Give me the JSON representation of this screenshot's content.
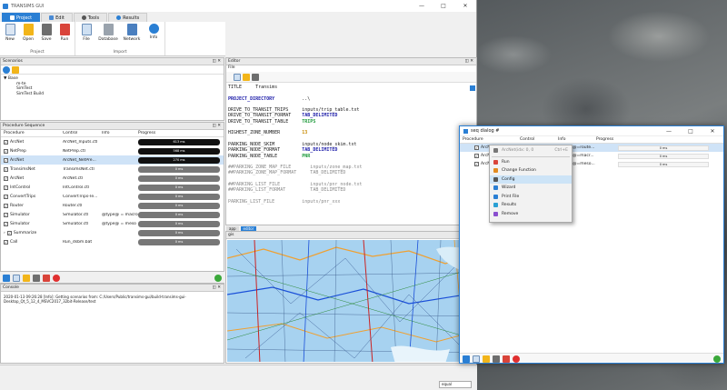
{
  "app": {
    "title": "TRANSIMS GUI",
    "tabs": [
      {
        "label": "Project"
      },
      {
        "label": "Edit"
      },
      {
        "label": "Tools"
      },
      {
        "label": "Results"
      }
    ]
  },
  "ribbon": {
    "project": {
      "label": "Project",
      "buttons": [
        "New",
        "Open",
        "Save",
        "Run"
      ]
    },
    "import": {
      "label": "Import",
      "buttons": [
        "File",
        "Database",
        "Network",
        "Info"
      ]
    }
  },
  "scenarios": {
    "title": "Scenarios",
    "root": "Base",
    "children": [
      "m-te",
      "SimTest",
      "SimTest Build"
    ]
  },
  "procedure": {
    "title": "Procedure Sequence",
    "headers": {
      "procedure": "Procedure",
      "control": "Control",
      "info": "Info",
      "progress": "Progress"
    },
    "rows": [
      {
        "name": "ArcNet",
        "control": "ArcNet_Inputs.ctl",
        "info": "",
        "progress": "613 ms",
        "dark": true,
        "selected": false
      },
      {
        "name": "NetPrep",
        "control": "NetPrep.ctl",
        "info": "",
        "progress": "568 ms",
        "dark": true,
        "selected": false
      },
      {
        "name": "ArcNet",
        "control": "ArcNet_NetPre...",
        "info": "",
        "progress": "270 ms",
        "dark": true,
        "selected": true
      },
      {
        "name": "TransimsNet",
        "control": "TransimsNet.ctl",
        "info": "",
        "progress": "0 ms",
        "dark": false,
        "selected": false
      },
      {
        "name": "ArcNet",
        "control": "ArcNet.ctl",
        "info": "",
        "progress": "0 ms",
        "dark": false,
        "selected": false
      },
      {
        "name": "IntControl",
        "control": "IntControl.ctl",
        "info": "",
        "progress": "0 ms",
        "dark": false,
        "selected": false
      },
      {
        "name": "ConvertTrips",
        "control": "ConvertTrips-Te...",
        "info": "",
        "progress": "0 ms",
        "dark": false,
        "selected": false
      },
      {
        "name": "Router",
        "control": "Router.ctl",
        "info": "",
        "progress": "0 ms",
        "dark": false,
        "selected": false
      },
      {
        "name": "Simulator",
        "control": "Simulator.ctl",
        "info": "@type@ = macro",
        "progress": "0 ms",
        "dark": false,
        "selected": false
      },
      {
        "name": "Simulator",
        "control": "Simulator.ctl",
        "info": "@type@ = meso",
        "progress": "0 ms",
        "dark": false,
        "selected": false
      },
      {
        "name": "Summarize",
        "control": "",
        "info": "",
        "progress": "0 ms",
        "dark": false,
        "selected": false
      },
      {
        "name": "Call",
        "control": "Run_dsbm.bat",
        "info": "",
        "progress": "0 ms",
        "dark": false,
        "selected": false
      }
    ]
  },
  "console": {
    "title": "Console",
    "text": "2020-01-13 09:26:28 [Info]: Getting scenarios from: C:/Users/Public/transims-gui/build-transims-gui-Desktop_Qt_5_12_4_MSVC2017_32bit-Release/test"
  },
  "editor": {
    "title": "Editor",
    "menu": "File",
    "tabs": [
      "app",
      "editor"
    ],
    "lines": [
      [
        {
          "t": "TITLE     Transims",
          "c": ""
        }
      ],
      [
        {
          "t": "",
          "c": ""
        }
      ],
      [
        {
          "t": "PROJECT_DIRECTORY",
          "c": "kw"
        },
        {
          "t": "          ..\\",
          "c": ""
        }
      ],
      [
        {
          "t": "",
          "c": ""
        }
      ],
      [
        {
          "t": "DRIVE_TO_TRANSIT_TRIPS     inputs/trip_table.txt",
          "c": ""
        }
      ],
      [
        {
          "t": "DRIVE_TO_TRANSIT_FORMAT    ",
          "c": ""
        },
        {
          "t": "TAB_DELIMITED",
          "c": "kw"
        }
      ],
      [
        {
          "t": "DRIVE_TO_TRANSIT_TABLE     ",
          "c": ""
        },
        {
          "t": "TRIPS",
          "c": "grn"
        }
      ],
      [
        {
          "t": "",
          "c": ""
        }
      ],
      [
        {
          "t": "HIGHEST_ZONE_NUMBER        ",
          "c": ""
        },
        {
          "t": "13",
          "c": "num"
        }
      ],
      [
        {
          "t": "",
          "c": ""
        }
      ],
      [
        {
          "t": "PARKING_NODE_SKIM          inputs/node_skim.txt",
          "c": ""
        }
      ],
      [
        {
          "t": "PARKING_NODE_FORMAT        ",
          "c": ""
        },
        {
          "t": "TAB_DELIMITED",
          "c": "kw"
        }
      ],
      [
        {
          "t": "PARKING_NODE_TABLE         ",
          "c": ""
        },
        {
          "t": "PNR",
          "c": "grn"
        }
      ],
      [
        {
          "t": "",
          "c": ""
        }
      ],
      [
        {
          "t": "##PARKING_ZONE_MAP_FILE       inputs/zone_map.txt",
          "c": "cm"
        }
      ],
      [
        {
          "t": "##PARKING_ZONE_MAP_FORMAT     TAB_DELIMITED",
          "c": "cm"
        }
      ],
      [
        {
          "t": "",
          "c": ""
        }
      ],
      [
        {
          "t": "##PARKING_LIST_FILE           inputs/pnr_node.txt",
          "c": "cm"
        }
      ],
      [
        {
          "t": "##PARKING_LIST_FORMAT         TAB_DELIMITED",
          "c": "cm"
        }
      ],
      [
        {
          "t": "",
          "c": ""
        }
      ],
      [
        {
          "t": "PARKING_LIST_FILE          inputs/pnr_xxx",
          "c": "cm"
        }
      ]
    ]
  },
  "gis": {
    "title": "gis"
  },
  "status": {
    "field": "equal"
  },
  "dialog": {
    "title": "seq dialog #",
    "headers": {
      "procedure": "Procedure",
      "control": "Control",
      "info": "Info",
      "progress": "Progress"
    },
    "rows": [
      {
        "name": "ArcNet",
        "info": "@=route...",
        "progress": "0 ms",
        "selected": true
      },
      {
        "name": "ArcNet",
        "info": "@=macr...",
        "progress": "0 ms",
        "selected": false
      },
      {
        "name": "ArcNet",
        "info": "@=meso...",
        "progress": "0 ms",
        "selected": false
      }
    ]
  },
  "context_menu": {
    "items": [
      {
        "label": "ArcNet(idx: 0, 0",
        "shortcut": "Ctrl+E",
        "disabled": true,
        "icon": "#777",
        "selected": false
      },
      {
        "label": "Run",
        "shortcut": "",
        "disabled": false,
        "icon": "#d9443a",
        "selected": false
      },
      {
        "label": "Change Function",
        "shortcut": "",
        "disabled": false,
        "icon": "#e38b1f",
        "selected": false
      },
      {
        "label": "Config",
        "shortcut": "",
        "disabled": false,
        "icon": "#555",
        "selected": true
      },
      {
        "label": "Wizard",
        "shortcut": "",
        "disabled": false,
        "icon": "#2a7fd4",
        "selected": false
      },
      {
        "label": "Print File",
        "shortcut": "",
        "disabled": false,
        "icon": "#2a7fd4",
        "selected": false
      },
      {
        "label": "Results",
        "shortcut": "",
        "disabled": false,
        "icon": "#2aa0d4",
        "selected": false
      },
      {
        "label": "Remove",
        "shortcut": "",
        "disabled": false,
        "icon": "#8a4fcf",
        "selected": false
      }
    ]
  },
  "colors": {
    "accent": "#2a7fd4",
    "progress_dark": "#111111",
    "progress_idle": "#777777"
  }
}
